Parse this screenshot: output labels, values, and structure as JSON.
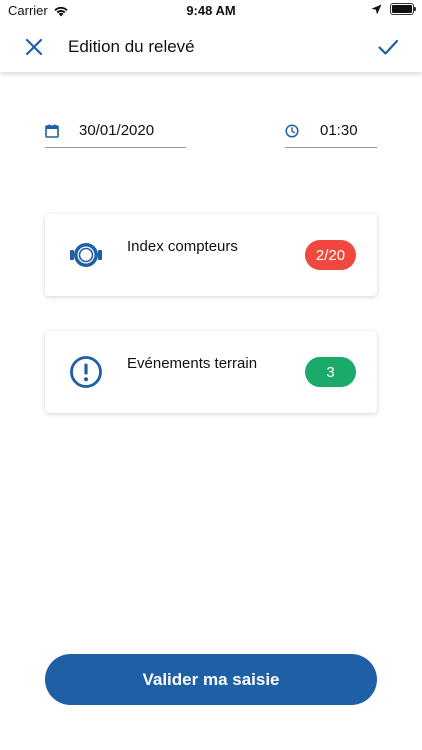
{
  "status_bar": {
    "carrier": "Carrier",
    "time": "9:48 AM"
  },
  "header": {
    "title": "Edition du relevé"
  },
  "form": {
    "date_value": "30/01/2020",
    "time_value": "01:30"
  },
  "cards": [
    {
      "label": "Index compteurs",
      "badge": "2/20",
      "badge_color": "#f0483e",
      "icon": "meter-icon"
    },
    {
      "label": "Evénements terrain",
      "badge": "3",
      "badge_color": "#1aaa6a",
      "icon": "alert-circle-icon"
    }
  ],
  "submit_label": "Valider ma saisie",
  "colors": {
    "accent": "#1f5fa6",
    "icon_blue": "#1f5fa6",
    "badge_red": "#f0483e",
    "badge_green": "#1aaa6a"
  }
}
